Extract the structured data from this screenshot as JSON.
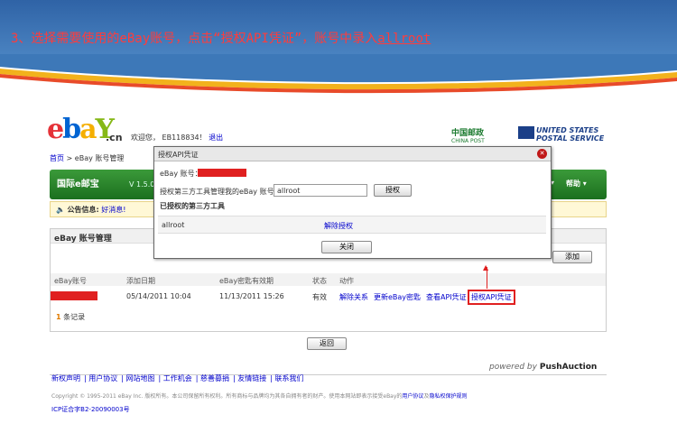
{
  "banner": {
    "text": "3、选择需要使用的eBay账号，点击“授权API凭证”，账号中录入",
    "underlined": "allroot"
  },
  "header": {
    "logo_e": "e",
    "logo_b": "b",
    "logo_a": "a",
    "logo_y": "Y",
    "logo_cn": ".cn",
    "welcome": "欢迎您，",
    "user": "EB118834！",
    "logout": "退出",
    "china_post": "中国邮政",
    "china_post_en": "CHINA POST",
    "usps_line1": "UNITED STATES",
    "usps_line2": "POSTAL SERVICE"
  },
  "breadcrumb": {
    "home": "首页",
    "sep": " > ",
    "current": "eBay 账号管理"
  },
  "nav": {
    "brand": "国际e邮宝",
    "version": "V 1.5.0",
    "help": "帮助"
  },
  "notice": {
    "label": "公告信息:",
    "text": "好消息!"
  },
  "section": {
    "title": "eBay 账号管理",
    "add_button": "添加",
    "columns": [
      "eBay账号",
      "添加日期",
      "eBay密匙有效期",
      "状态",
      "动作"
    ],
    "row": {
      "added": "05/14/2011 10:04",
      "expires": "11/13/2011 15:26",
      "status": "有效",
      "actions": [
        "解除关系",
        "更新eBay密匙",
        "查看API凭证",
        "授权API凭证"
      ]
    },
    "count": "1",
    "count_label": "条记录",
    "back_button": "返回"
  },
  "modal": {
    "title": "授权API凭证",
    "account_label": "eBay 账号：",
    "auth_label": "授权第三方工具管理我的eBay 账号",
    "input_value": "allroot",
    "auth_button": "授权",
    "authorized_title": "已授权的第三方工具",
    "tool_name": "allroot",
    "revoke": "解除授权",
    "close_button": "关闭"
  },
  "footer": {
    "powered": "powered by",
    "brand": "PushAuction",
    "links": [
      "新权声明",
      "用户协议",
      "网站地图",
      "工作机会",
      "慈善募捐",
      "友情链接",
      "联系我们"
    ],
    "copyright": "Copyright © 1995-2011 eBay Inc. 版权所有。本公司保留所有权利。所有商标与品牌均为其各自拥有者的财产。使用本网站即表示接受eBay的",
    "user_agreement": "用户协议",
    "and": "及",
    "privacy": "隐私权保护规则",
    "icp": "ICP证合字B2-20090003号"
  },
  "colors": {
    "banner": "#3a72b4",
    "accent_red": "#e02020",
    "nav_green": "#2a852b"
  }
}
